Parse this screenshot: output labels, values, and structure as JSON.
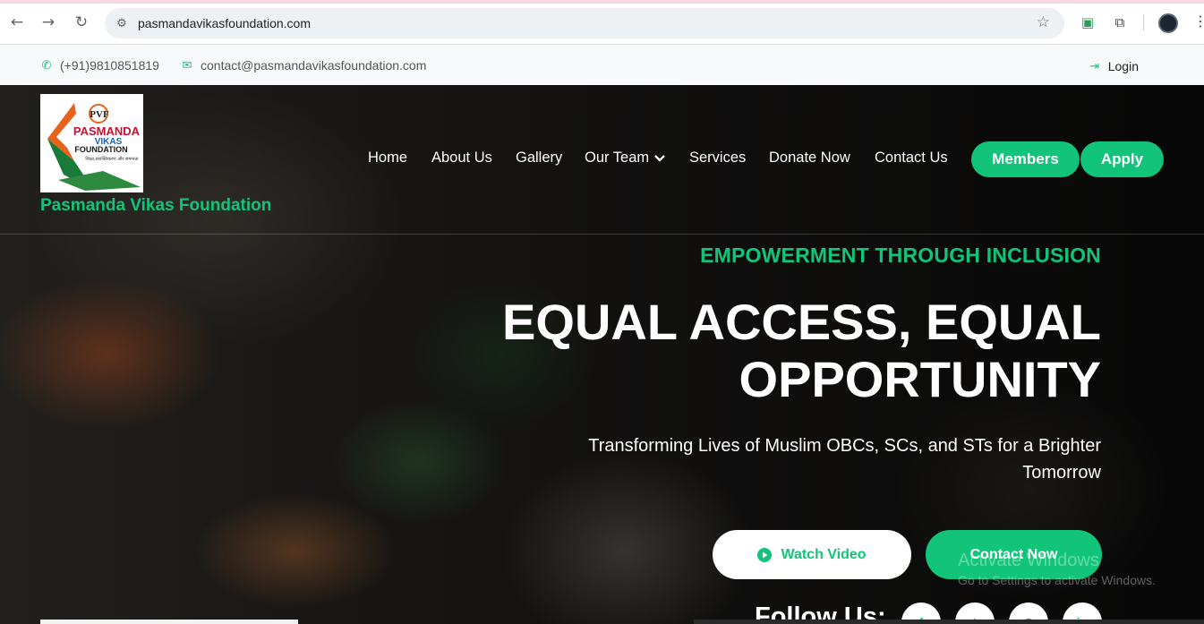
{
  "browser": {
    "url": "pasmandavikasfoundation.com"
  },
  "topbar": {
    "phone": "(+91)9810851819",
    "email": "contact@pasmandavikasfoundation.com",
    "login": "Login"
  },
  "logo": {
    "monogram": "PVF",
    "line1": "PASMANDA",
    "line2": "VIKAS",
    "line3": "FOUNDATION",
    "tagline": "शिक्षा,सशक्तिकरण और समानता",
    "brand_name": "Pasmanda Vikas Foundation"
  },
  "nav": {
    "items": [
      "Home",
      "About Us",
      "Gallery",
      "Our Team",
      "Services",
      "Donate Now",
      "Contact Us"
    ],
    "members": "Members",
    "apply": "Apply"
  },
  "hero": {
    "eyebrow": "EMPOWERMENT THROUGH INCLUSION",
    "headline_line1": "EQUAL ACCESS, EQUAL",
    "headline_line2": "OPPORTUNITY",
    "subtitle": "Transforming Lives of Muslim OBCs, SCs, and STs for a Brighter Tomorrow",
    "watch_video": "Watch Video",
    "contact_now": "Contact Now",
    "follow_us": "Follow Us:"
  },
  "windows_watermark": {
    "title": "Activate Windows",
    "subtitle": "Go to Settings to activate Windows."
  },
  "colors": {
    "accent": "#12c47a"
  }
}
